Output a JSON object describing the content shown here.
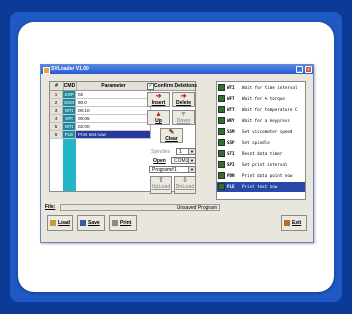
{
  "window": {
    "title": "SVLoader V1.00",
    "min_glyph": "_",
    "close_glyph": "×"
  },
  "grid": {
    "headers": [
      "#",
      "CMD",
      "Parameter"
    ],
    "rows": [
      {
        "num": "1",
        "cmd": "SSP",
        "param": "02"
      },
      {
        "num": "2",
        "cmd": "SSM",
        "param": " 90.0"
      },
      {
        "num": "3",
        "cmd": "WTI",
        "param": "00:10"
      },
      {
        "num": "4",
        "cmd": "SPI",
        "param": "00:05"
      },
      {
        "num": "5",
        "cmd": "WTI",
        "param": "02:00"
      },
      {
        "num": "6",
        "cmd": "PLE",
        "param": "Print test now",
        "selected": true
      }
    ]
  },
  "controls": {
    "confirm_label": "Confirm Deletions",
    "confirm_checked": "✓",
    "insert": "Insert",
    "delete": "Delete",
    "up": "Up",
    "down": "Down",
    "clear": "Clear",
    "spindles_label": "Spindles",
    "spindles_value": "1",
    "open_label": "Open",
    "port_value": "COM1",
    "program_value": "Program#1",
    "upload": "UpLoad",
    "download": "DnLoad"
  },
  "commands": [
    {
      "code": "WTI",
      "desc": "Wait for time interval"
    },
    {
      "code": "WFT",
      "desc": "Wait for % torque"
    },
    {
      "code": "WTT",
      "desc": "Wait for temperature C"
    },
    {
      "code": "WKY",
      "desc": "Wait for a keypress"
    },
    {
      "code": "SSM",
      "desc": "Set viscometer speed"
    },
    {
      "code": "SSP",
      "desc": "Set spindle"
    },
    {
      "code": "STI",
      "desc": "Reset data timer"
    },
    {
      "code": "SPI",
      "desc": "Set print interval"
    },
    {
      "code": "PDN",
      "desc": "Print data point now"
    },
    {
      "code": "PLE",
      "desc": "Print text now",
      "selected": true
    }
  ],
  "file": {
    "label": "File:",
    "status": "Unsaved Program"
  },
  "buttons": {
    "load": "Load",
    "save": "Save",
    "print": "Print",
    "exit": "Exit"
  }
}
